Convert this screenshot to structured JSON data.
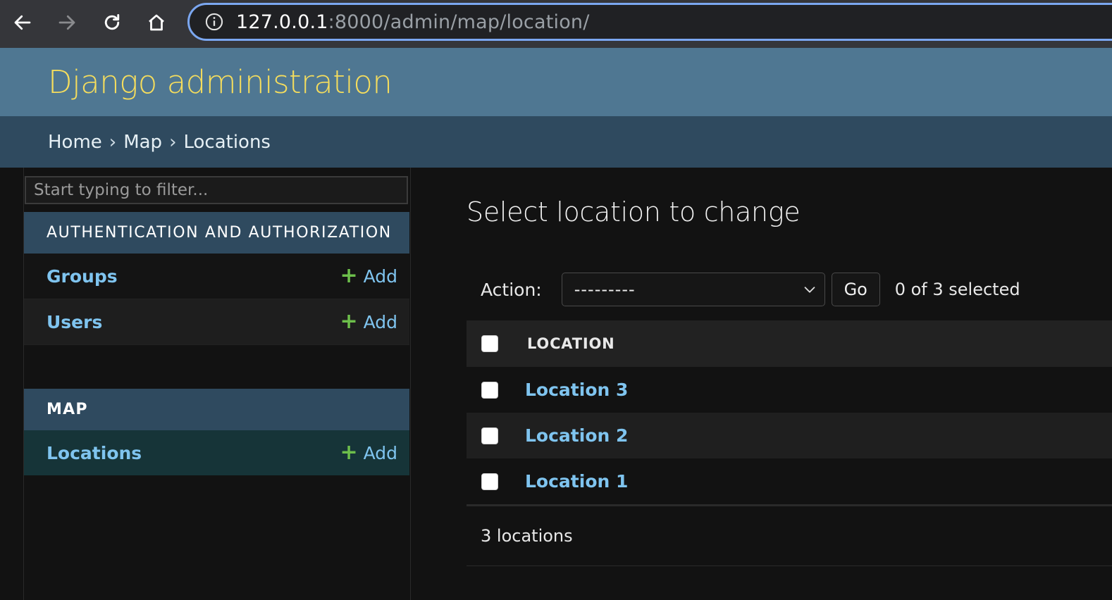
{
  "browser": {
    "url_host": "127.0.0.1",
    "url_path": ":8000/admin/map/location/",
    "icons": [
      "back-arrow-icon",
      "forward-arrow-icon",
      "reload-icon",
      "home-icon",
      "info-icon"
    ]
  },
  "header": {
    "site_title": "Django administration"
  },
  "breadcrumbs": {
    "items": [
      "Home",
      "Map",
      "Locations"
    ],
    "separator": "›"
  },
  "sidebar": {
    "filter_placeholder": "Start typing to filter...",
    "apps": [
      {
        "caption": "AUTHENTICATION AND AUTHORIZATION",
        "models": [
          {
            "name": "Groups",
            "add_label": "Add"
          },
          {
            "name": "Users",
            "add_label": "Add"
          }
        ]
      },
      {
        "caption": "MAP",
        "models": [
          {
            "name": "Locations",
            "add_label": "Add"
          }
        ]
      }
    ]
  },
  "content": {
    "title": "Select location to change",
    "action_label": "Action:",
    "action_selected": "---------",
    "go_label": "Go",
    "selection_status": "0 of 3 selected",
    "column_header": "LOCATION",
    "rows": [
      "Location 3",
      "Location 2",
      "Location 1"
    ],
    "result_count": "3 locations"
  },
  "colors": {
    "header_bg": "#4f7792",
    "breadcrumb_bg": "#2f4a5f",
    "site_title": "#f5dd5d",
    "link": "#7fc4ef",
    "add_plus": "#6dbf4b",
    "selected_model_bg": "#163438"
  }
}
